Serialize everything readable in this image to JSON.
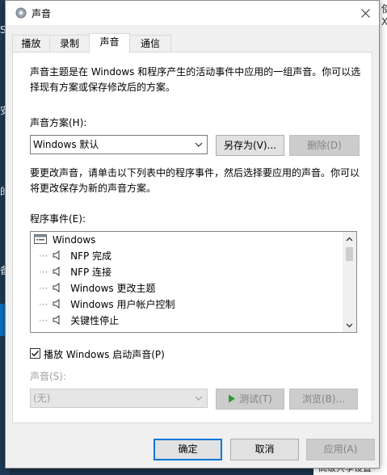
{
  "dialog": {
    "title": "声音",
    "tabs": [
      {
        "label": "播放",
        "active": false
      },
      {
        "label": "录制",
        "active": false
      },
      {
        "label": "声音",
        "active": true
      },
      {
        "label": "通信",
        "active": false
      }
    ],
    "intro": "声音主题是在 Windows 和程序产生的活动事件中应用的一组声音。你可以选择现有方案或保存修改后的方案。",
    "scheme_label": "声音方案(H):",
    "scheme_value": "Windows 默认",
    "save_as_label": "另存为(V)...",
    "delete_label": "删除(D)",
    "instructions": "要更改声音，请单击以下列表中的程序事件，然后选择要应用的声音。你可以将更改保存为新的声音方案。",
    "events_label": "程序事件(E):",
    "events": [
      {
        "label": "Windows"
      },
      {
        "label": "NFP 完成"
      },
      {
        "label": "NFP 连接"
      },
      {
        "label": "Windows 更改主题"
      },
      {
        "label": "Windows 用户帐户控制"
      },
      {
        "label": "关键性停止"
      }
    ],
    "startup_sound_label": "播放 Windows 启动声音(P)",
    "startup_sound_checked": true,
    "sound_label": "声音(S):",
    "sound_value": "(无)",
    "test_label": "测试(T)",
    "browse_label": "浏览(B)...",
    "ok_label": "确定",
    "cancel_label": "取消",
    "apply_label": "应用(A)"
  },
  "background": {
    "left_fragments": [
      "S",
      "安",
      "的",
      "备"
    ],
    "right_fragments": [
      "使",
      "X"
    ],
    "bottom_fragment": "高级共享设置"
  },
  "colors": {
    "accent": "#0078d7",
    "desktop": "#1b3147",
    "disabled_text": "#a0a0a0"
  }
}
